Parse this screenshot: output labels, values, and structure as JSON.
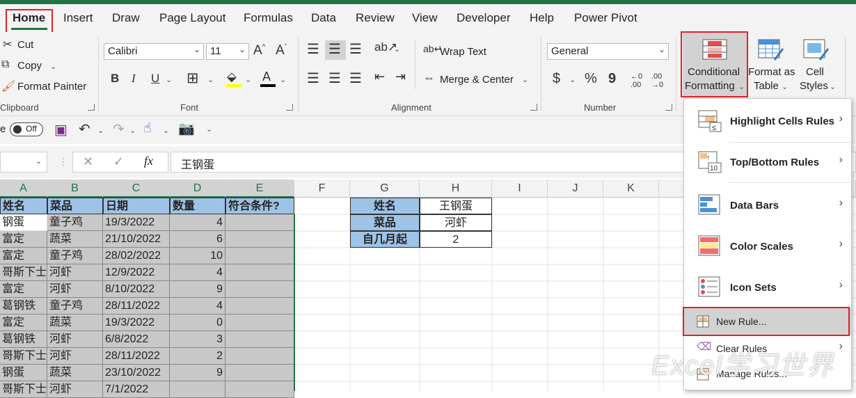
{
  "tabs": [
    "Home",
    "Insert",
    "Draw",
    "Page Layout",
    "Formulas",
    "Data",
    "Review",
    "View",
    "Developer",
    "Help",
    "Power Pivot"
  ],
  "clipboard": {
    "cut": "Cut",
    "copy": "Copy",
    "format_painter": "Format Painter",
    "group": "Clipboard"
  },
  "font": {
    "name": "Calibri",
    "size": "11",
    "group": "Font",
    "grow": "A^",
    "shrink": "Aˇ",
    "bold": "B",
    "italic": "I",
    "underline": "U"
  },
  "alignment": {
    "wrap_text": "Wrap Text",
    "merge_center": "Merge & Center",
    "group": "Alignment"
  },
  "number": {
    "format": "General",
    "group": "Number",
    "currency": "$",
    "percent": "%",
    "comma": "9"
  },
  "styles": {
    "conditional_formatting": [
      "Conditional",
      "Formatting"
    ],
    "format_as_table": [
      "Format as",
      "Table"
    ],
    "cell_styles": [
      "Cell",
      "Styles"
    ]
  },
  "qat": {
    "autosave_label": "e",
    "toggle": "Off"
  },
  "formula_bar": {
    "content": "王钢蛋",
    "fx": "fx"
  },
  "columns": [
    "A",
    "B",
    "C",
    "D",
    "E",
    "F",
    "G",
    "H",
    "I",
    "J",
    "K"
  ],
  "table_headers": [
    "姓名",
    "菜品",
    "日期",
    "数量",
    "符合条件?"
  ],
  "table_rows": [
    [
      "钢蛋",
      "童子鸡",
      "19/3/2022",
      "4",
      ""
    ],
    [
      "富定",
      "蔬菜",
      "21/10/2022",
      "6",
      ""
    ],
    [
      "富定",
      "童子鸡",
      "28/02/2022",
      "10",
      ""
    ],
    [
      "哥斯下士",
      "河虾",
      "12/9/2022",
      "4",
      ""
    ],
    [
      "富定",
      "河虾",
      "8/10/2022",
      "9",
      ""
    ],
    [
      "葛钢铁",
      "童子鸡",
      "28/11/2022",
      "4",
      ""
    ],
    [
      "富定",
      "蔬菜",
      "19/3/2022",
      "0",
      ""
    ],
    [
      "葛钢铁",
      "河虾",
      "6/8/2022",
      "3",
      ""
    ],
    [
      "哥斯下士",
      "河虾",
      "28/11/2022",
      "2",
      ""
    ],
    [
      "钢蛋",
      "蔬菜",
      "23/10/2022",
      "9",
      ""
    ],
    [
      "哥斯下士",
      "河虾",
      "7/1/2022",
      "",
      ""
    ]
  ],
  "criteria": [
    {
      "label": "姓名",
      "value": "王钢蛋"
    },
    {
      "label": "菜品",
      "value": "河虾"
    },
    {
      "label": "自几月起",
      "value": "2"
    }
  ],
  "cf_menu": {
    "items": [
      "Highlight Cells Rules",
      "Top/Bottom Rules",
      "Data Bars",
      "Color Scales",
      "Icon Sets"
    ],
    "new_rule": "New Rule...",
    "clear_rules": "Clear Rules",
    "manage_rules": "Manage Rules..."
  },
  "watermark": "Excel学习世界",
  "colors": {
    "accent": "#217346",
    "highlight": "#e0202a",
    "header_fill": "#9dc3e6",
    "gray_fill": "#c8c8c8"
  }
}
